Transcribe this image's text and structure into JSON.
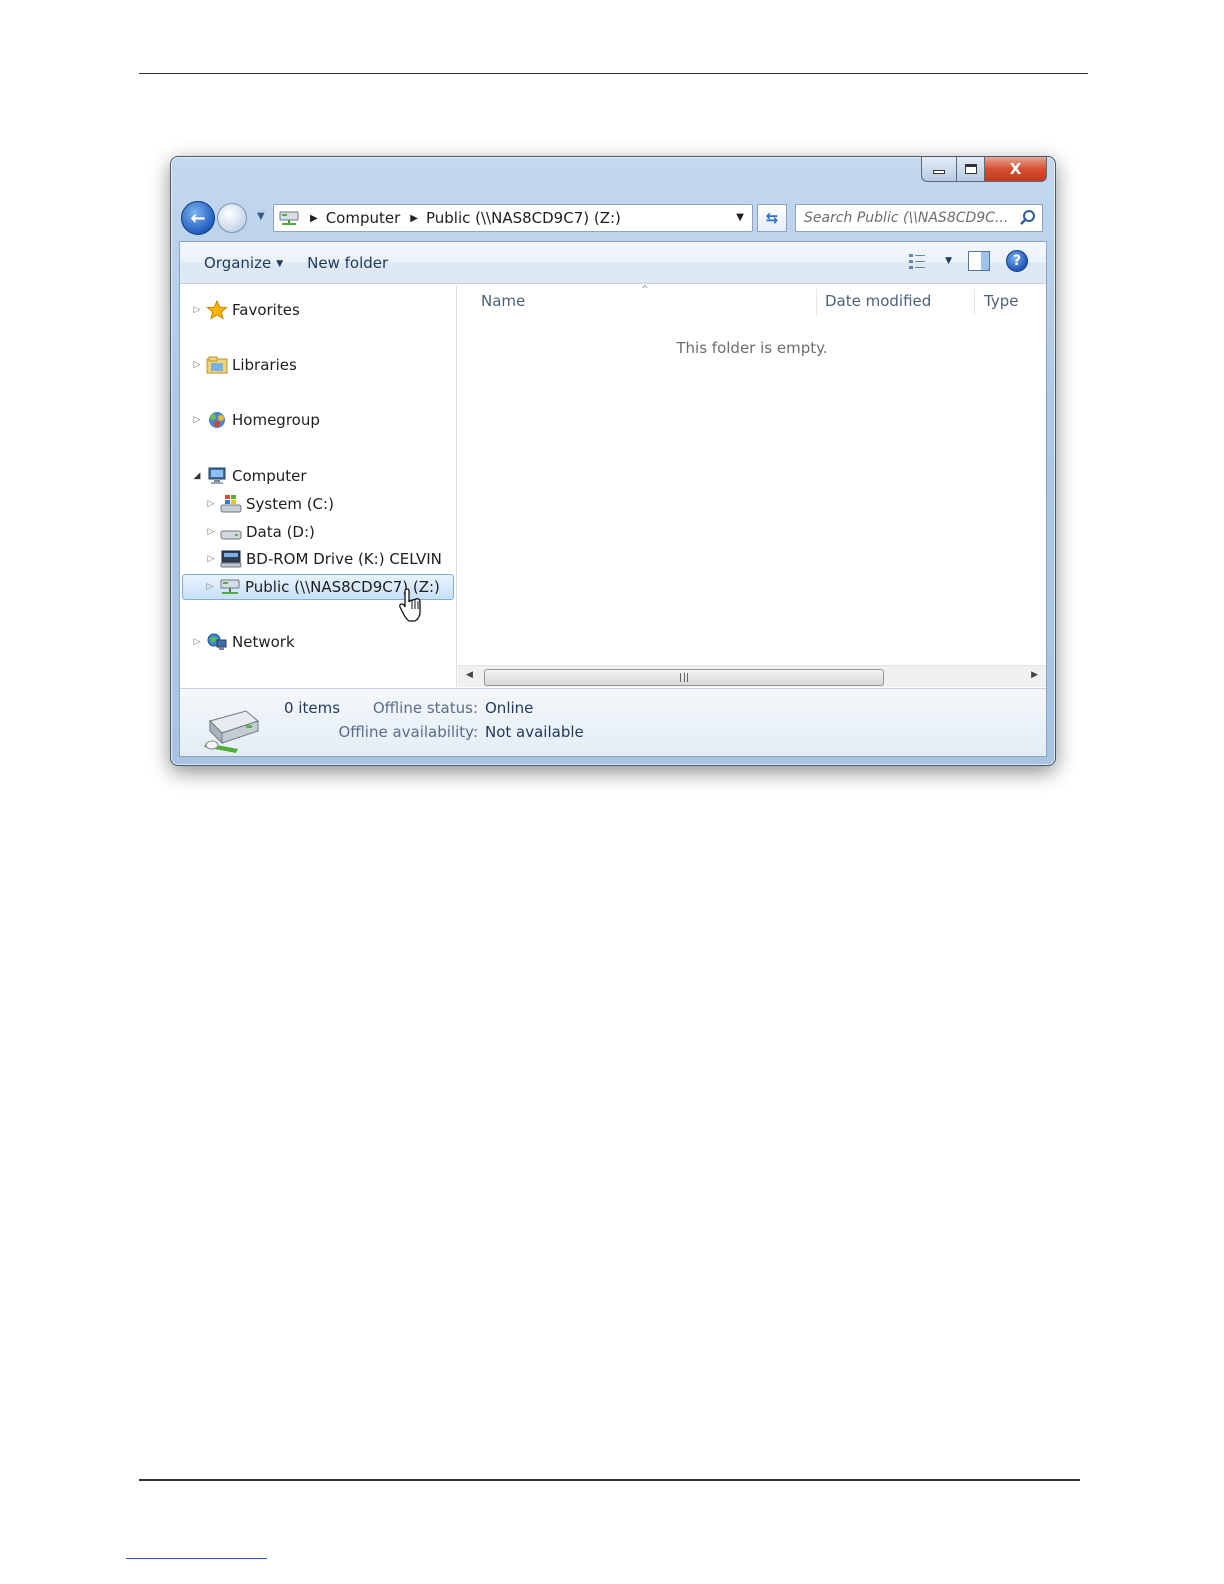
{
  "window": {
    "caption_close": "X"
  },
  "address": {
    "segments": [
      "Computer",
      "Public (\\\\NAS8CD9C7) (Z:)"
    ],
    "search_placeholder": "Search Public (\\\\NAS8CD9C..."
  },
  "toolbar": {
    "organize_label": "Organize",
    "new_folder_label": "New folder",
    "help_glyph": "?"
  },
  "nav_tree": {
    "favorites": "Favorites",
    "libraries": "Libraries",
    "homegroup": "Homegroup",
    "computer": "Computer",
    "system": "System (C:)",
    "data": "Data (D:)",
    "bdrom": "BD-ROM Drive (K:) CELVIN",
    "public": "Public (\\\\NAS8CD9C7) (Z:)",
    "network": "Network"
  },
  "file_list": {
    "columns": [
      "Name",
      "Date modified",
      "Type"
    ],
    "empty_message": "This folder is empty."
  },
  "details": {
    "item_count": "0 items",
    "offline_status_label": "Offline status:",
    "offline_status_value": "Online",
    "offline_availability_label": "Offline availability:",
    "offline_availability_value": "Not available"
  },
  "colors": {
    "selection": "#c7e0f8",
    "close_button": "#c13a1c",
    "accent": "#1e5fc0"
  },
  "icons": [
    "back-arrow-icon",
    "forward-arrow-icon",
    "network-drive-icon",
    "refresh-icon",
    "search-icon",
    "view-options-icon",
    "preview-pane-icon",
    "help-icon",
    "star-icon",
    "libraries-icon",
    "homegroup-icon",
    "computer-icon",
    "windows-drive-icon",
    "hard-drive-icon",
    "optical-drive-icon",
    "network-globe-icon",
    "hand-cursor-icon"
  ]
}
